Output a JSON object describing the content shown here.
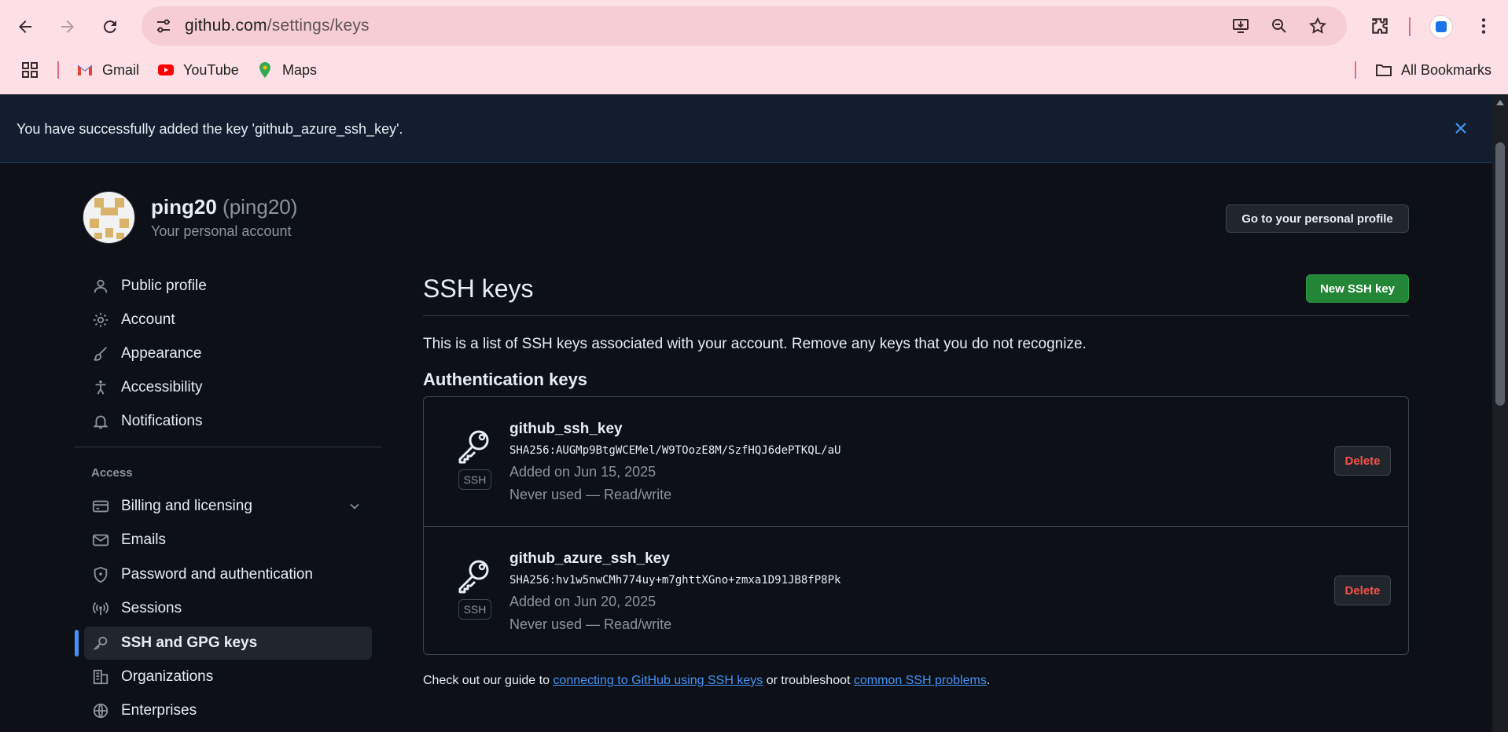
{
  "browser": {
    "url_host": "github.com",
    "url_path": "/settings/keys",
    "bookmarks": [
      {
        "label": "Gmail",
        "icon": "gmail-icon"
      },
      {
        "label": "YouTube",
        "icon": "youtube-icon"
      },
      {
        "label": "Maps",
        "icon": "maps-icon"
      }
    ],
    "all_bookmarks_label": "All Bookmarks"
  },
  "flash": {
    "message": "You have successfully added the key 'github_azure_ssh_key'."
  },
  "header": {
    "display_name": "ping20",
    "login": "(ping20)",
    "subtitle": "Your personal account",
    "profile_button": "Go to your personal profile"
  },
  "sidebar": {
    "items": [
      {
        "label": "Public profile",
        "icon": "person-icon"
      },
      {
        "label": "Account",
        "icon": "gear-icon"
      },
      {
        "label": "Appearance",
        "icon": "paintbrush-icon"
      },
      {
        "label": "Accessibility",
        "icon": "accessibility-icon"
      },
      {
        "label": "Notifications",
        "icon": "bell-icon"
      }
    ],
    "access_heading": "Access",
    "access_items": [
      {
        "label": "Billing and licensing",
        "icon": "credit-card-icon"
      },
      {
        "label": "Emails",
        "icon": "mail-icon"
      },
      {
        "label": "Password and authentication",
        "icon": "shield-icon"
      },
      {
        "label": "Sessions",
        "icon": "broadcast-icon"
      },
      {
        "label": "SSH and GPG keys",
        "icon": "key-icon",
        "active": true
      },
      {
        "label": "Organizations",
        "icon": "organization-icon"
      },
      {
        "label": "Enterprises",
        "icon": "globe-icon"
      }
    ]
  },
  "main": {
    "title": "SSH keys",
    "new_key_button": "New SSH key",
    "intro": "This is a list of SSH keys associated with your account. Remove any keys that you do not recognize.",
    "auth_heading": "Authentication keys",
    "keys": [
      {
        "name": "github_ssh_key",
        "fingerprint": "SHA256:AUGMp9BtgWCEMel/W9TOozE8M/SzfHQJ6dePTKQL/aU",
        "added": "Added on Jun 15, 2025",
        "usage": "Never used — Read/write",
        "badge": "SSH",
        "delete_label": "Delete"
      },
      {
        "name": "github_azure_ssh_key",
        "fingerprint": "SHA256:hv1w5nwCMh774uy+m7ghttXGno+zmxa1D91JB8fP8Pk",
        "added": "Added on Jun 20, 2025",
        "usage": "Never used — Read/write",
        "badge": "SSH",
        "delete_label": "Delete"
      }
    ],
    "guide_prefix": "Check out our guide to ",
    "guide_link1": "connecting to GitHub using SSH keys",
    "guide_middle": " or troubleshoot ",
    "guide_link2": "common SSH problems",
    "guide_suffix": "."
  },
  "colors": {
    "accent_blue": "#4493f8",
    "green_button": "#238636",
    "danger": "#f85149",
    "page_bg": "#0d1117",
    "chrome_bg": "#fde0e6"
  }
}
